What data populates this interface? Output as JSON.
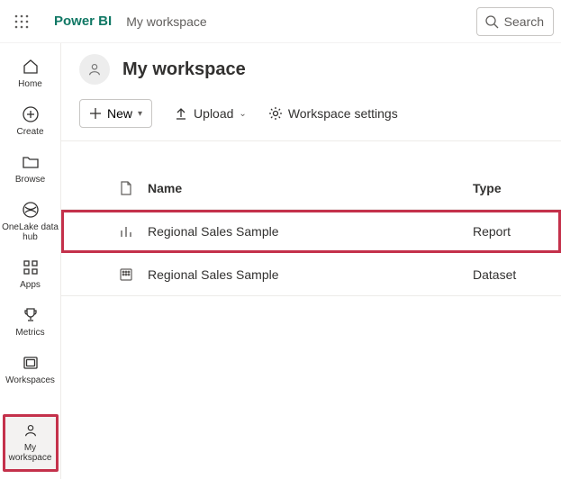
{
  "brand": "Power BI",
  "breadcrumb": "My workspace",
  "search": {
    "placeholder": "Search"
  },
  "nav": {
    "home": "Home",
    "create": "Create",
    "browse": "Browse",
    "datahub": "OneLake data hub",
    "apps": "Apps",
    "metrics": "Metrics",
    "workspaces": "Workspaces",
    "my_workspace": "My workspace"
  },
  "workspace": {
    "title": "My workspace"
  },
  "toolbar": {
    "new": "New",
    "upload": "Upload",
    "settings": "Workspace settings"
  },
  "table": {
    "headers": {
      "name": "Name",
      "type": "Type"
    },
    "rows": [
      {
        "name": "Regional Sales Sample",
        "type": "Report",
        "highlight": true,
        "icon": "report"
      },
      {
        "name": "Regional Sales Sample",
        "type": "Dataset",
        "highlight": false,
        "icon": "dataset"
      }
    ]
  }
}
